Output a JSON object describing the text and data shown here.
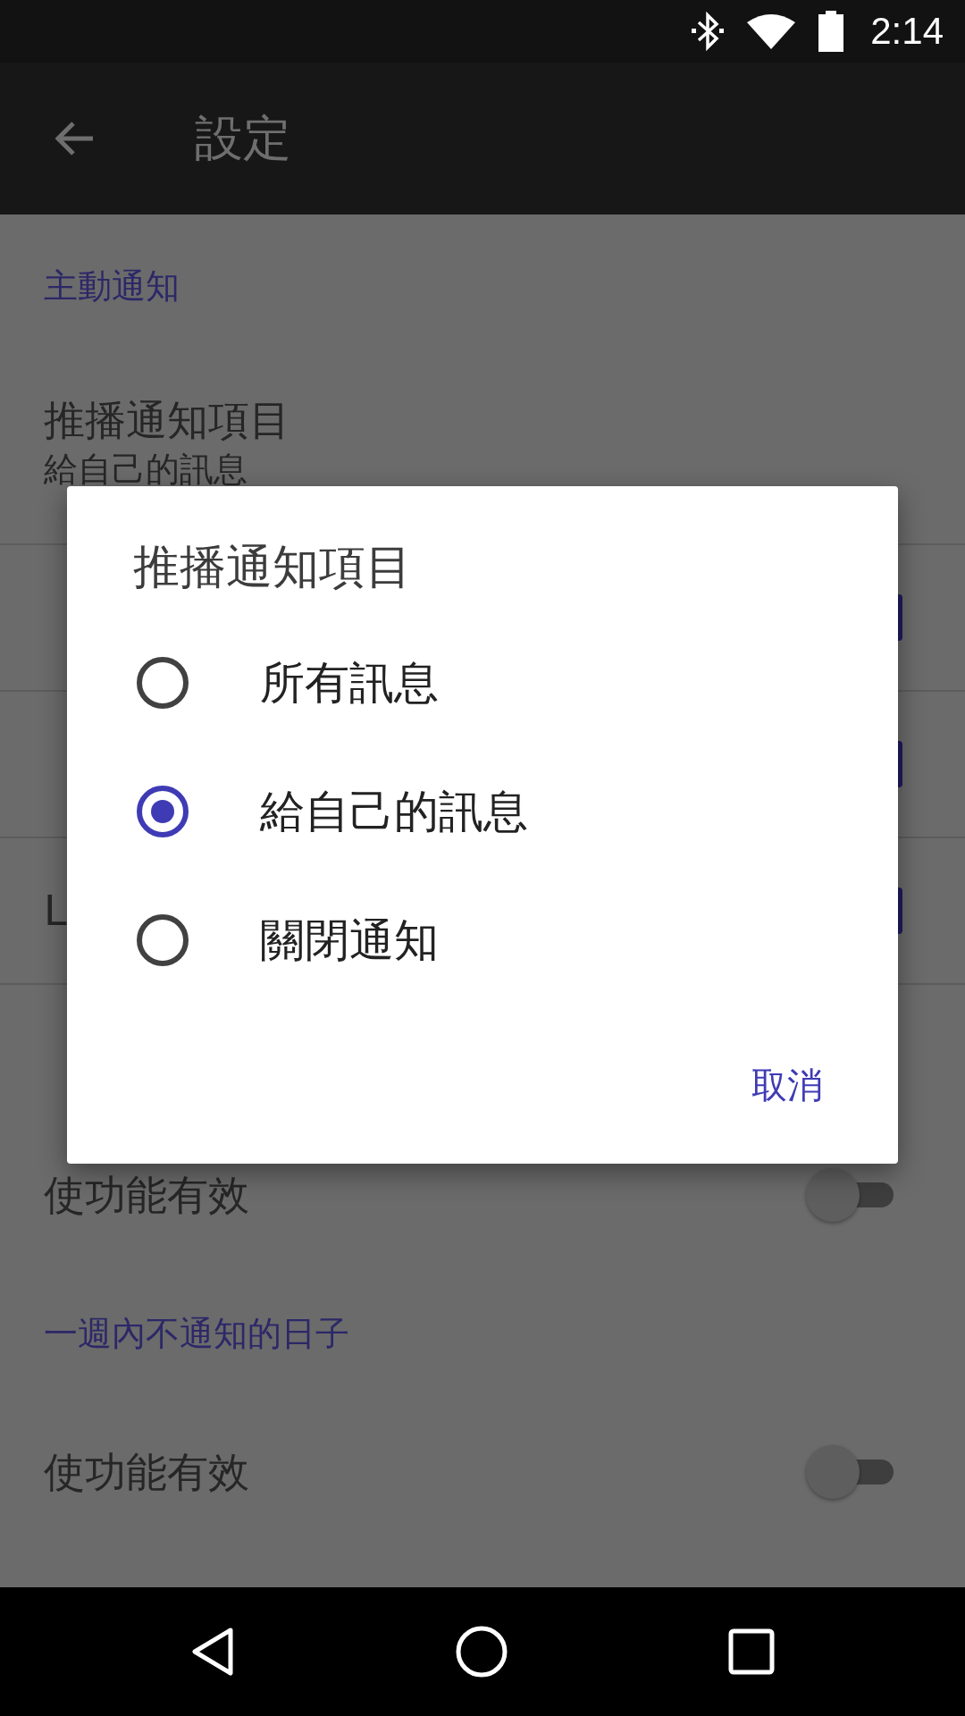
{
  "status_bar": {
    "time": "2:14"
  },
  "toolbar": {
    "title": "設定"
  },
  "settings": [
    {
      "kind": "header",
      "text": "主動通知"
    },
    {
      "kind": "item",
      "title": "推播通知項目",
      "subtitle": "給自己的訊息"
    },
    {
      "kind": "checkbox",
      "checked": true
    },
    {
      "kind": "checkbox",
      "checked": true
    },
    {
      "kind": "checkbox",
      "title": "L",
      "checked": true
    },
    {
      "kind": "header"
    },
    {
      "kind": "switch",
      "title": "使功能有效",
      "on": false
    },
    {
      "kind": "header",
      "text": "一週內不通知的日子"
    },
    {
      "kind": "switch",
      "title": "使功能有效",
      "on": false
    }
  ],
  "dialog": {
    "title": "推播通知項目",
    "options": [
      {
        "label": "所有訊息",
        "selected": false
      },
      {
        "label": "給自己的訊息",
        "selected": true
      },
      {
        "label": "關閉通知",
        "selected": false
      }
    ],
    "buttons": [
      "取消"
    ]
  }
}
